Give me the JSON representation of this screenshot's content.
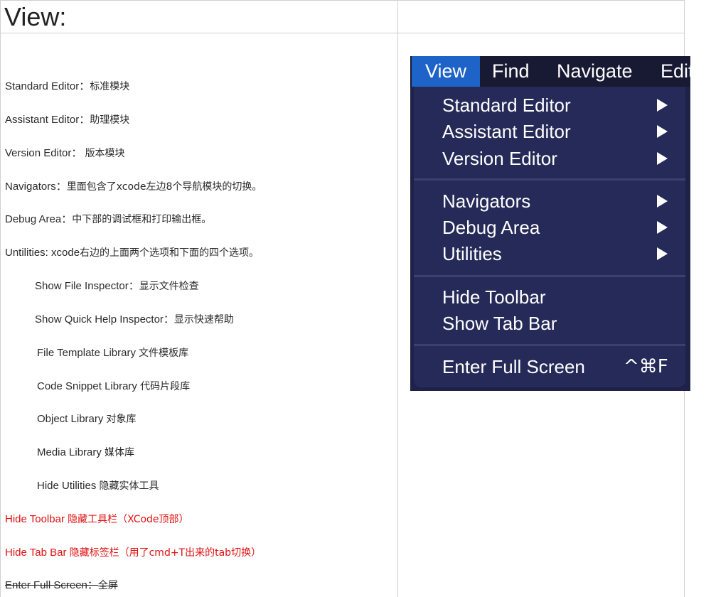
{
  "title": "View:",
  "left_items": [
    {
      "en": "Standard Editor：",
      "zh": "标准模块"
    },
    {
      "en": "Assistant Editor：",
      "zh": "助理模块"
    },
    {
      "en": "Version Editor： ",
      "zh": "版本模块"
    },
    {
      "en": "Navigators：",
      "zh": "里面包含了xcode左边8个导航模块的切换。"
    },
    {
      "en": "Debug Area：",
      "zh": "中下部的调试框和打印输出框。"
    },
    {
      "en": "Untilities: xcode",
      "zh": "右边的上面两个选项和下面的四个选项。"
    },
    {
      "en": "Show File Inspector：",
      "zh": "显示文件检查"
    },
    {
      "en": "Show Quick Help Inspector：",
      "zh": "显示快速帮助"
    },
    {
      "en": "File Template Library ",
      "zh": "文件模板库"
    },
    {
      "en": "Code Snippet Library ",
      "zh": "代码片段库"
    },
    {
      "en": "Object Library ",
      "zh": "对象库"
    },
    {
      "en": "Media Library ",
      "zh": "媒体库"
    },
    {
      "en": "Hide Utilities ",
      "zh": "隐藏实体工具"
    },
    {
      "en": "Hide Toolbar ",
      "zh": "隐藏工具栏（XCode顶部）"
    },
    {
      "en": "Hide Tab Bar ",
      "zh": "隐藏标签栏（用了cmd+T出来的tab切换）"
    },
    {
      "en": "Enter Full Screen：",
      "zh": "全屏"
    }
  ],
  "colors": {
    "highlight": "#e01010",
    "menu_bg": "#252a58",
    "menu_selected": "#1e63c8"
  },
  "menu": {
    "bar": [
      "View",
      "Find",
      "Navigate",
      "Edit"
    ],
    "items": [
      "Standard Editor",
      "Assistant Editor",
      "Version Editor",
      "Navigators",
      "Debug Area",
      "Utilities",
      "Hide Toolbar",
      "Show Tab Bar",
      "Enter Full Screen"
    ],
    "shortcut": "^⌘F"
  }
}
